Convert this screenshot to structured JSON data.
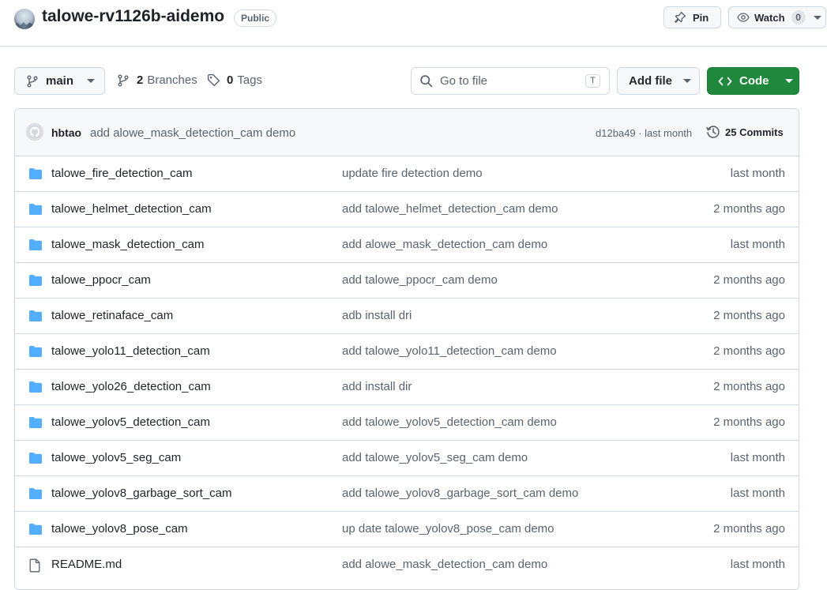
{
  "repo": {
    "name": "talowe-rv1126b-aidemo",
    "visibility": "Public",
    "pin_label": "Pin",
    "watch_label": "Watch",
    "watch_count": "0"
  },
  "toolbar": {
    "branch": "main",
    "branches_count": "2",
    "branches_label": "Branches",
    "tags_count": "0",
    "tags_label": "Tags",
    "search_placeholder": "Go to file",
    "search_shortcut": "T",
    "add_file_label": "Add file",
    "code_label": "Code"
  },
  "latest_commit": {
    "author": "hbtao",
    "message": "add alowe_mask_detection_cam demo",
    "meta": "d12ba49 · last month",
    "commits_label": "25 Commits"
  },
  "files": [
    {
      "type": "folder",
      "name": "talowe_fire_detection_cam",
      "message": "update fire detection demo",
      "date": "last month"
    },
    {
      "type": "folder",
      "name": "talowe_helmet_detection_cam",
      "message": "add talowe_helmet_detection_cam demo",
      "date": "2 months ago"
    },
    {
      "type": "folder",
      "name": "talowe_mask_detection_cam",
      "message": "add alowe_mask_detection_cam demo",
      "date": "last month"
    },
    {
      "type": "folder",
      "name": "talowe_ppocr_cam",
      "message": "add talowe_ppocr_cam demo",
      "date": "2 months ago"
    },
    {
      "type": "folder",
      "name": "talowe_retinaface_cam",
      "message": "adb install dri",
      "date": "2 months ago"
    },
    {
      "type": "folder",
      "name": "talowe_yolo11_detection_cam",
      "message": "add talowe_yolo11_detection_cam demo",
      "date": "2 months ago"
    },
    {
      "type": "folder",
      "name": "talowe_yolo26_detection_cam",
      "message": "add install dir",
      "date": "2 months ago"
    },
    {
      "type": "folder",
      "name": "talowe_yolov5_detection_cam",
      "message": "add talowe_yolov5_detection_cam demo",
      "date": "2 months ago"
    },
    {
      "type": "folder",
      "name": "talowe_yolov5_seg_cam",
      "message": "add talowe_yolov5_seg_cam demo",
      "date": "last month"
    },
    {
      "type": "folder",
      "name": "talowe_yolov8_garbage_sort_cam",
      "message": "add talowe_yolov8_garbage_sort_cam demo",
      "date": "last month"
    },
    {
      "type": "folder",
      "name": "talowe_yolov8_pose_cam",
      "message": "up date talowe_yolov8_pose_cam demo",
      "date": "2 months ago"
    },
    {
      "type": "file",
      "name": "README.md",
      "message": "add alowe_mask_detection_cam demo",
      "date": "last month"
    }
  ],
  "colors": {
    "accent_green": "#1f883d",
    "folder_blue": "#54aeff",
    "border": "#d1d9e0",
    "muted_text": "#59636e"
  }
}
